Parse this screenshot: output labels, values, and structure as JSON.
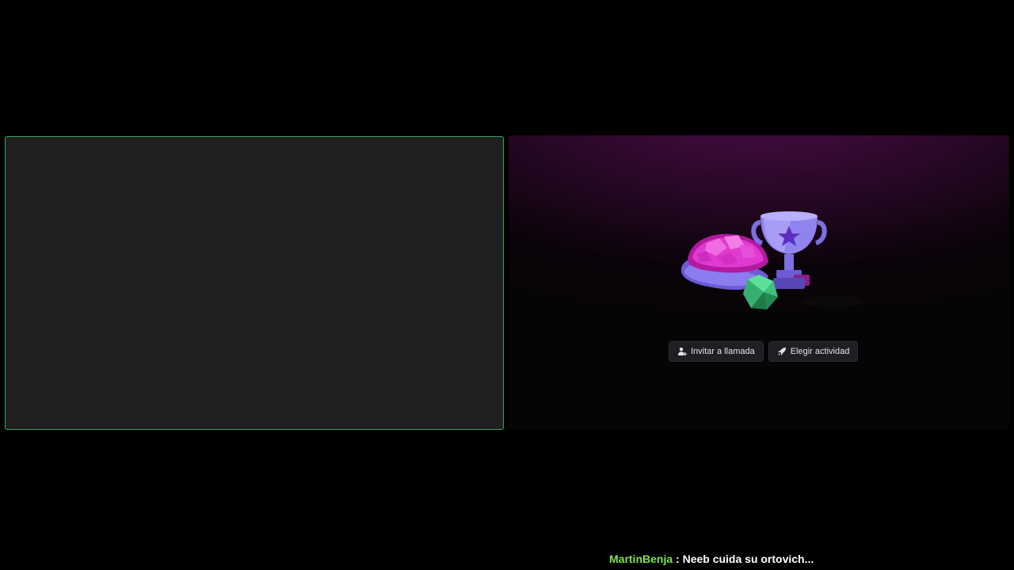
{
  "colors": {
    "background": "#000000",
    "tile_background": "#202020",
    "speaking_border": "#3ba55c",
    "button_background": "#1e1f22",
    "button_text": "#e3e5e8",
    "chat_username": "#7ee34a",
    "chat_text": "#ffffff",
    "panel_glow": "#4a0c45"
  },
  "activity_panel": {
    "illustration_icon": "trophy-shell-dice-illustration",
    "buttons": [
      {
        "label": "Invitar a llamada",
        "icon": "add-person-icon"
      },
      {
        "label": "Elegir actividad",
        "icon": "rocket-icon"
      }
    ]
  },
  "chat": {
    "username": "MartinBenja",
    "separator": " : ",
    "message": "Neeb cuida su ortovich..."
  }
}
